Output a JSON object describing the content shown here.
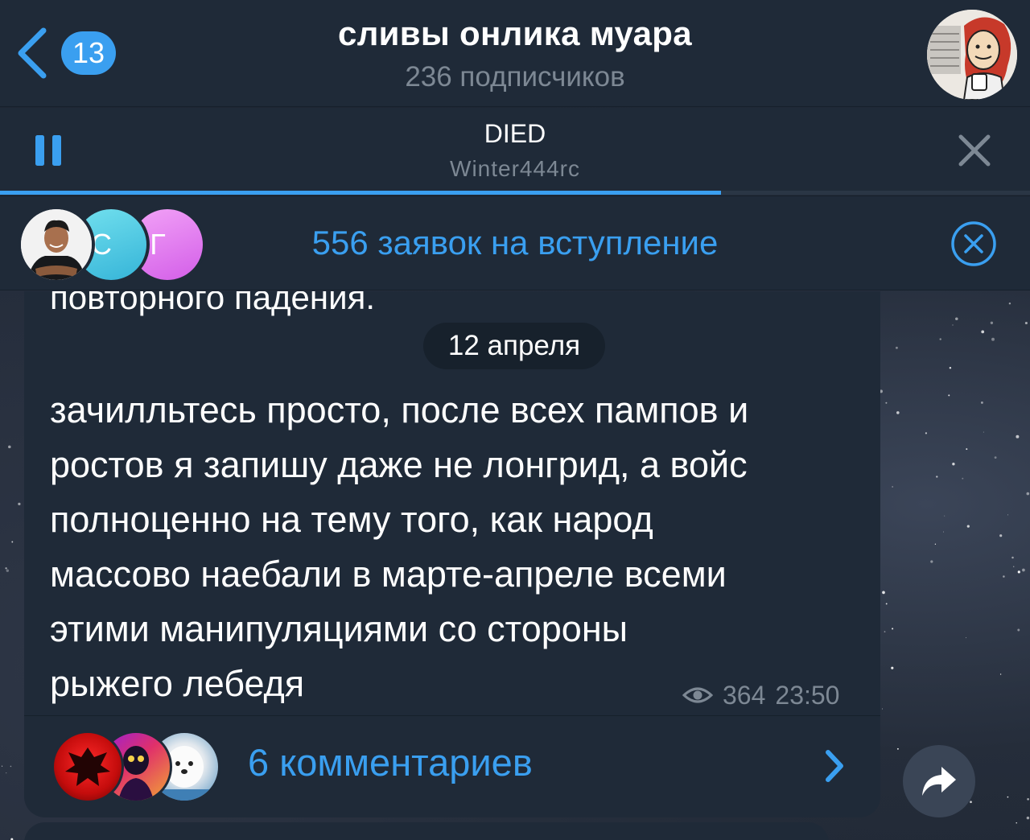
{
  "header": {
    "back_badge": "13",
    "title": "сливы онлика муара",
    "subtitle": "236 подписчиков",
    "avatar_icon": "meme-avatar"
  },
  "player": {
    "track_title": "DIED",
    "track_artist": "Winter444rc",
    "progress": 0.7,
    "pause_icon": "pause-icon",
    "close_icon": "close-icon"
  },
  "requests": {
    "label": "556 заявок на вступление",
    "avatars": [
      {
        "letter": ""
      },
      {
        "letter": "С"
      },
      {
        "letter": "Г"
      }
    ]
  },
  "message": {
    "prev_text_tail": "повторного падения.",
    "date": "12 апреля",
    "lines": [
      "зачилльтесь просто, после всех пампов и",
      "ростов я запишу даже не лонгрид, а войс",
      "полноценно на тему того, как народ",
      "массово наебали в марте-апреле всеми",
      "этими манипуляциями со стороны",
      "рыжего лебедя"
    ],
    "views": "364",
    "time": "23:50",
    "comments_label": "6 комментариев"
  },
  "colors": {
    "accent": "#3a9ff0",
    "panel": "#1f2a38",
    "muted": "#7d8894"
  }
}
